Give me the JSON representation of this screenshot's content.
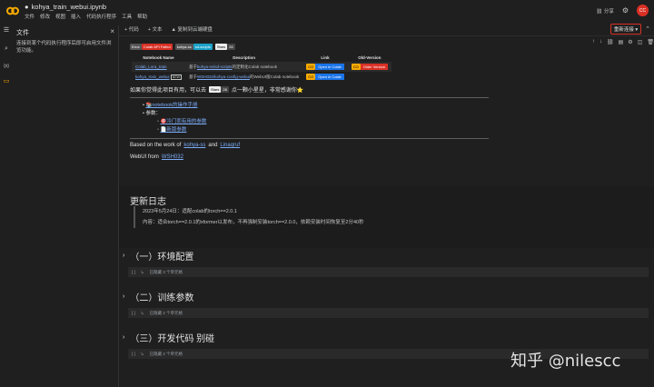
{
  "header": {
    "notebook_title": "kohya_train_webui.ipynb",
    "menus": [
      "文件",
      "修改",
      "视图",
      "插入",
      "代码执行程序",
      "工具",
      "帮助"
    ],
    "share_label": "分享",
    "avatar_initials": "CC",
    "brand_color": "#f9ab00",
    "avatar_color": "#d93025"
  },
  "files_panel": {
    "title": "文件",
    "message": "连接到某个代码执行程序后即可启用文件浏览功能。"
  },
  "toolbar": {
    "add_code": "+ 代码",
    "add_text": "+ 文本",
    "copy_to_drive": "复制到云端硬盘",
    "reconnect": "重新连接"
  },
  "notebook": {
    "badges": [
      "Error",
      "Colab API Failed",
      "kohya-ss",
      "sd-scripts",
      "Stars",
      "28"
    ],
    "table": {
      "headers": [
        "Notebook Name",
        "Description",
        "Link",
        "Old-Version"
      ],
      "rows": [
        {
          "name": "Colab_Lora_train",
          "desc_prefix": "基于",
          "desc_link": "kohya-ss/sd-scripts",
          "desc_suffix": "的定制化Colab notebook",
          "open_label": "Open in Colab",
          "old_label": "Older Version"
        },
        {
          "name": "kohya_train_webui",
          "tag": "NEW",
          "desc_prefix": "基于",
          "desc_link": "WSH032/kohya-config-webui",
          "desc_suffix": "的WebUI版Colab notebook",
          "open_label": "Open in Colab",
          "old_label": ""
        }
      ]
    },
    "star_line_before": "如果你觉得此项目有用，可以去",
    "star_badge": "Stars",
    "star_count": "28",
    "star_line_after": "点一颗小星星，非常感谢你⭐",
    "bullet_manual": "📚notebook的操作手册",
    "bullet_params": "参数：",
    "sub_common": "🎯冷门而有用的参数",
    "sub_new": "📄新版参数",
    "based_prefix": "Based on the work of",
    "based_link1": "kohya-ss",
    "based_and": "and",
    "based_link2": "Linaqruf",
    "webui_prefix": "WebUI from",
    "webui_link": "WSH032"
  },
  "changelog": {
    "title": "更新日志",
    "line1": "2023年5月24日：适配colab的torch==2.0.1",
    "line2": "内容：适合torch==2.0.1的xformer以发布，不再强制安装torch==2.0.0，依赖安装时间恢复至2分40秒"
  },
  "sections": [
    {
      "title": "（一）环境配置",
      "hidden_label": "已隐藏 3 个单元格"
    },
    {
      "title": "（二）训练参数",
      "hidden_label": "已隐藏 2 个单元格"
    },
    {
      "title": "（三）开发代码 别碰",
      "hidden_label": "已隐藏 2 个单元格"
    }
  ],
  "cell_bracket": "[ ]",
  "watermark": "知乎 @nilescc"
}
